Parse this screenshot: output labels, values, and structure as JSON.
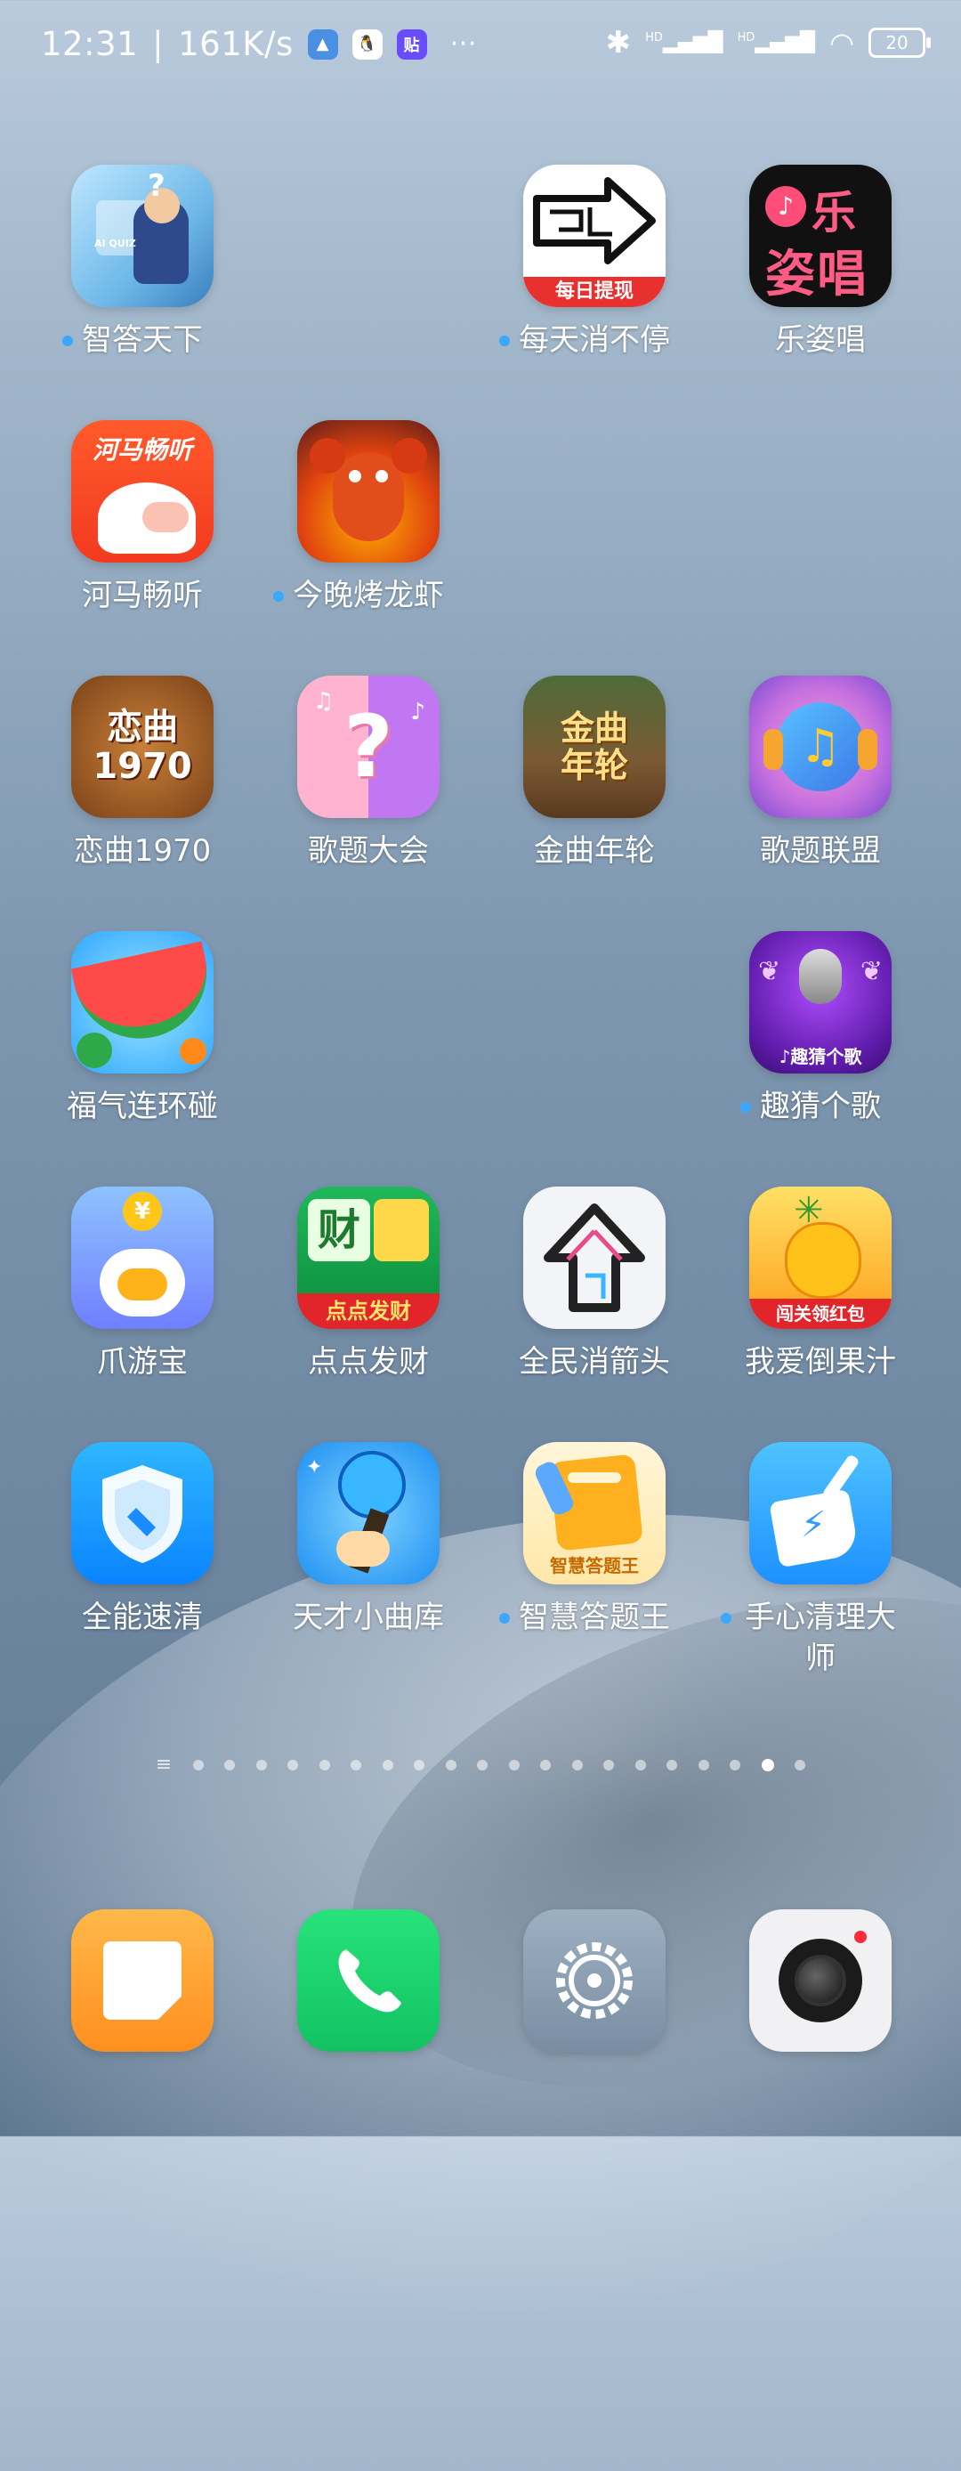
{
  "status_bar": {
    "time": "12:31",
    "speed": "161K/s",
    "more": "···",
    "battery": "20",
    "hd1": "HD",
    "hd2": "HD"
  },
  "apps": [
    {
      "label": "智答天下",
      "dot": true
    },
    {
      "label": "每天消不停",
      "dot": true
    },
    {
      "label": "乐姿唱",
      "dot": false
    },
    {
      "label": "河马畅听",
      "dot": false
    },
    {
      "label": "今晚烤龙虾",
      "dot": true
    },
    {
      "label": "恋曲1970",
      "dot": false
    },
    {
      "label": "歌题大会",
      "dot": false
    },
    {
      "label": "金曲年轮",
      "dot": false
    },
    {
      "label": "歌题联盟",
      "dot": false
    },
    {
      "label": "福气连环碰",
      "dot": false
    },
    {
      "label": "趣猜个歌",
      "dot": true
    },
    {
      "label": "爪游宝",
      "dot": false
    },
    {
      "label": "点点发财",
      "dot": false
    },
    {
      "label": "全民消箭头",
      "dot": false
    },
    {
      "label": "我爱倒果汁",
      "dot": false
    },
    {
      "label": "全能速清",
      "dot": false
    },
    {
      "label": "天才小曲库",
      "dot": false
    },
    {
      "label": "智慧答题王",
      "dot": true
    },
    {
      "label": "手心清理大师",
      "dot": true
    }
  ],
  "icon_text": {
    "lezichang": "乐\n姿唱",
    "meitian_badge": "每日提现",
    "hema": "河马畅听",
    "lianqu": "恋曲\n1970",
    "jinqu": "金曲\n年轮",
    "quicai": "♪趣猜个歌",
    "diandian_top": "财",
    "diandian_badge": "点点发财",
    "guozhi_badge": "闯关领红包",
    "zhihui_badge": "智慧答题王",
    "zhuayou_coin": "¥",
    "aiquiz": "AI QUIZ"
  },
  "pager": {
    "count": 20,
    "active_index": 19,
    "menu_glyph": "≡"
  },
  "dock": [
    "notes",
    "phone",
    "settings",
    "camera"
  ]
}
